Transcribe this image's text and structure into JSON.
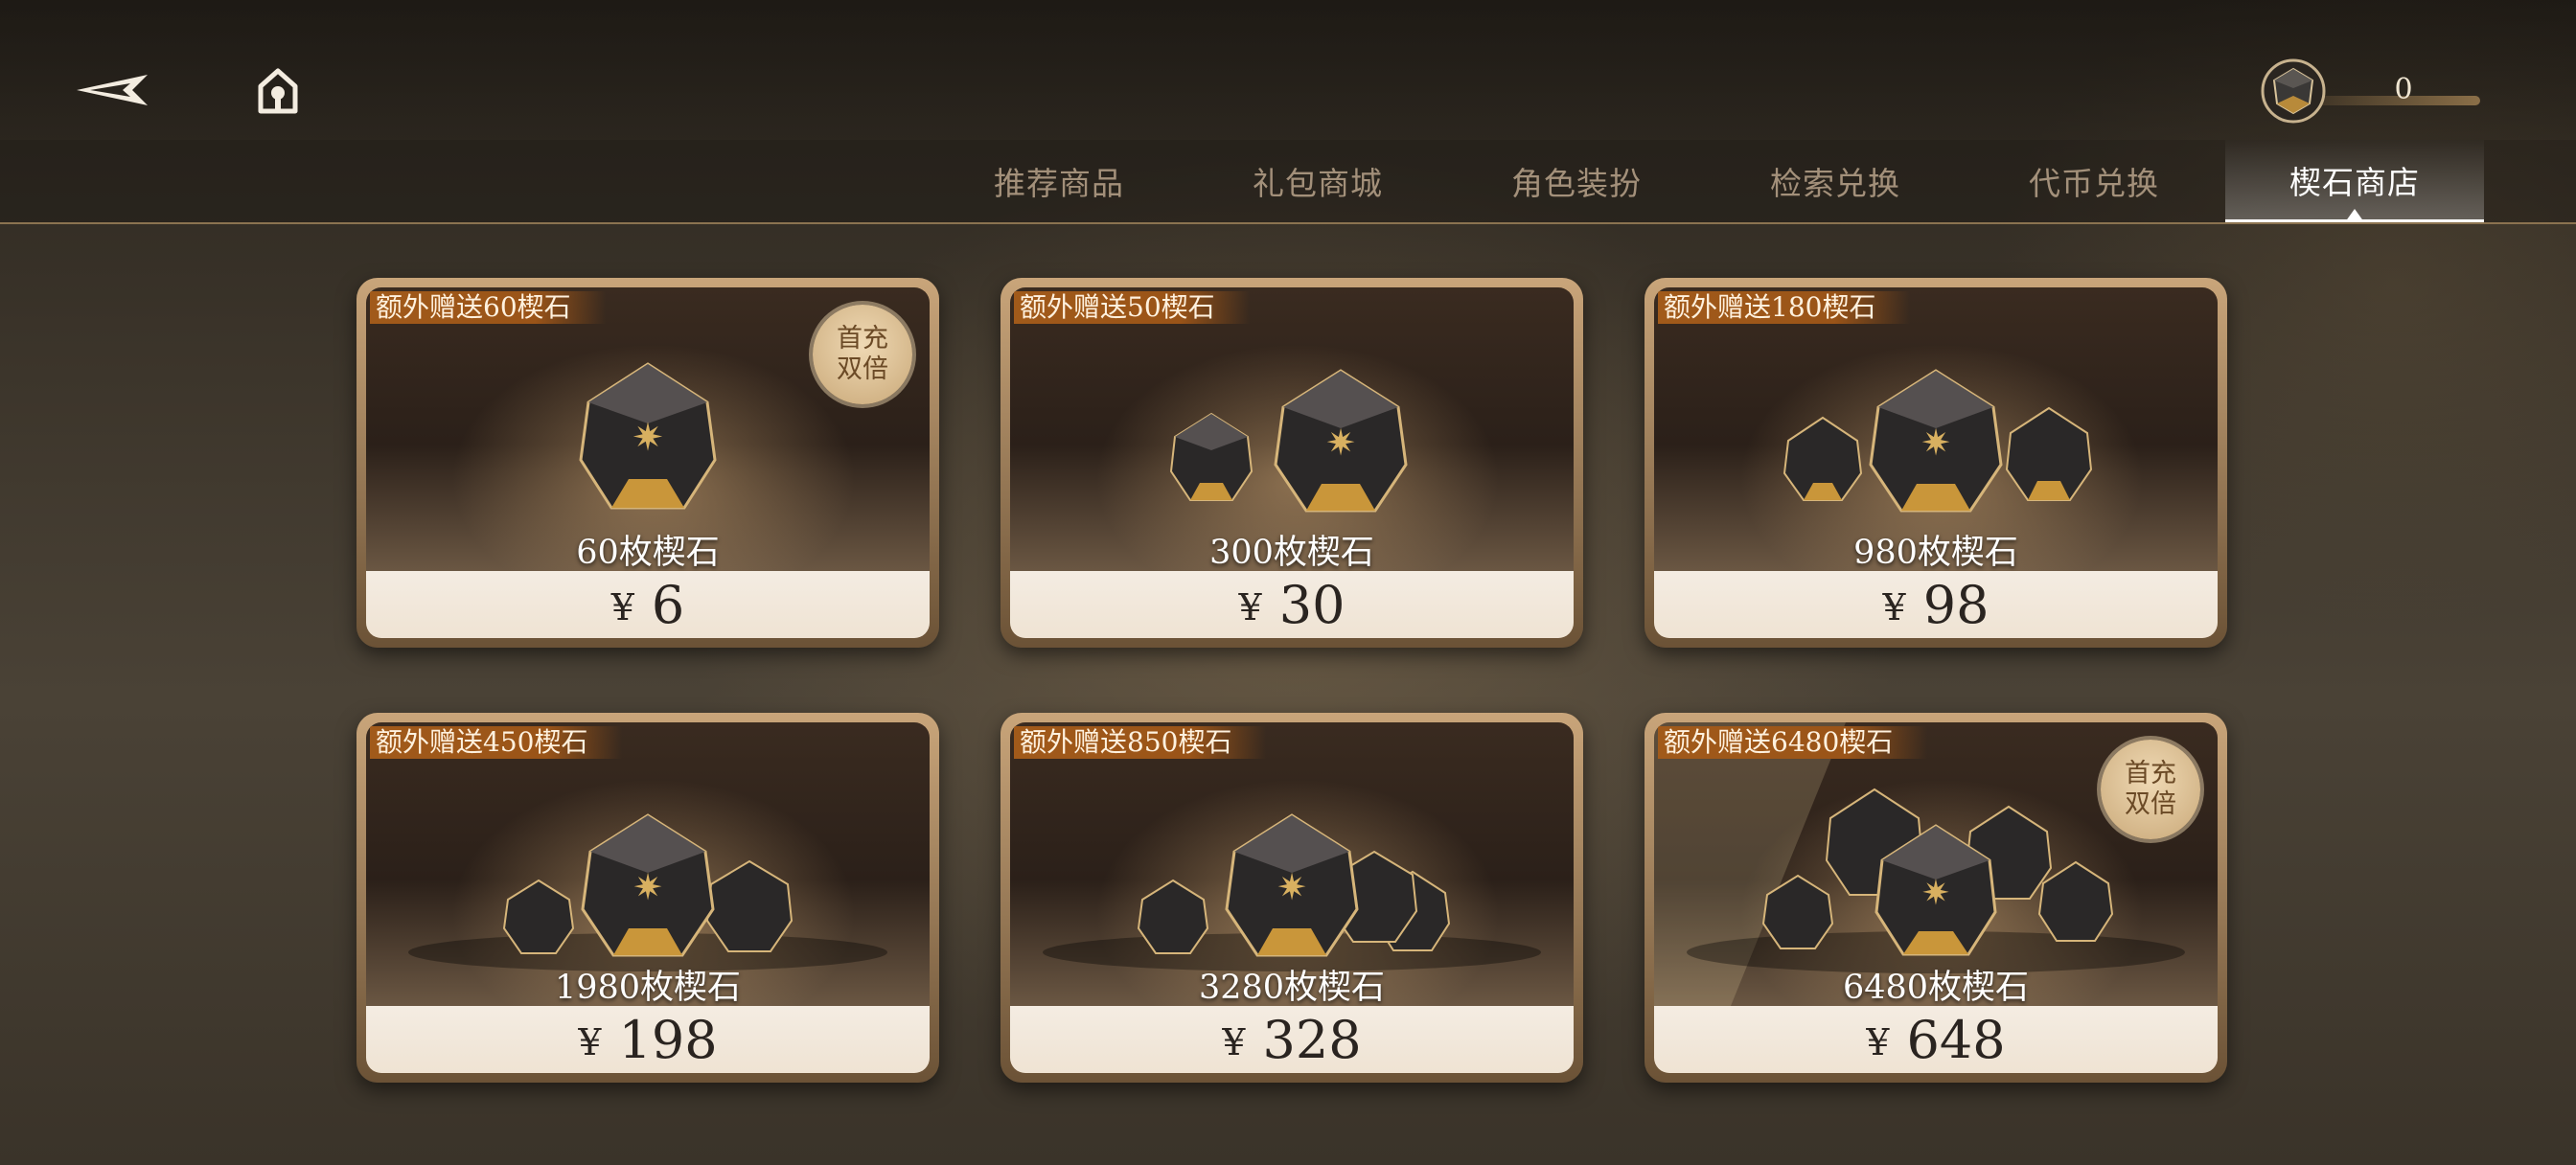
{
  "header": {
    "back_icon": "back-arrow-icon",
    "home_icon": "home-icon",
    "currency": {
      "icon": "gem-icon",
      "value": "0"
    }
  },
  "tabs": [
    {
      "label": "推荐商品",
      "active": false
    },
    {
      "label": "礼包商城",
      "active": false
    },
    {
      "label": "角色装扮",
      "active": false
    },
    {
      "label": "检索兑换",
      "active": false
    },
    {
      "label": "代币兑换",
      "active": false
    },
    {
      "label": "楔石商店",
      "active": true
    }
  ],
  "products": [
    {
      "bonus": "额外赠送60楔石",
      "amount": "60枚楔石",
      "currency_symbol": "¥",
      "price": "6",
      "badge": [
        "首充",
        "双倍"
      ],
      "gems": 1
    },
    {
      "bonus": "额外赠送50楔石",
      "amount": "300枚楔石",
      "currency_symbol": "¥",
      "price": "30",
      "badge": null,
      "gems": 2
    },
    {
      "bonus": "额外赠送180楔石",
      "amount": "980枚楔石",
      "currency_symbol": "¥",
      "price": "98",
      "badge": null,
      "gems": 3
    },
    {
      "bonus": "额外赠送450楔石",
      "amount": "1980枚楔石",
      "currency_symbol": "¥",
      "price": "198",
      "badge": null,
      "gems": 4
    },
    {
      "bonus": "额外赠送850楔石",
      "amount": "3280枚楔石",
      "currency_symbol": "¥",
      "price": "328",
      "badge": null,
      "gems": 5
    },
    {
      "bonus": "额外赠送6480楔石",
      "amount": "6480枚楔石",
      "currency_symbol": "¥",
      "price": "648",
      "badge": [
        "首充",
        "双倍"
      ],
      "gems": 8
    }
  ],
  "colors": {
    "accent_gold": "#c9a57a",
    "tag_orange": "#a15a1a",
    "tab_inactive": "#a3907a",
    "tab_active": "#ffffff"
  }
}
